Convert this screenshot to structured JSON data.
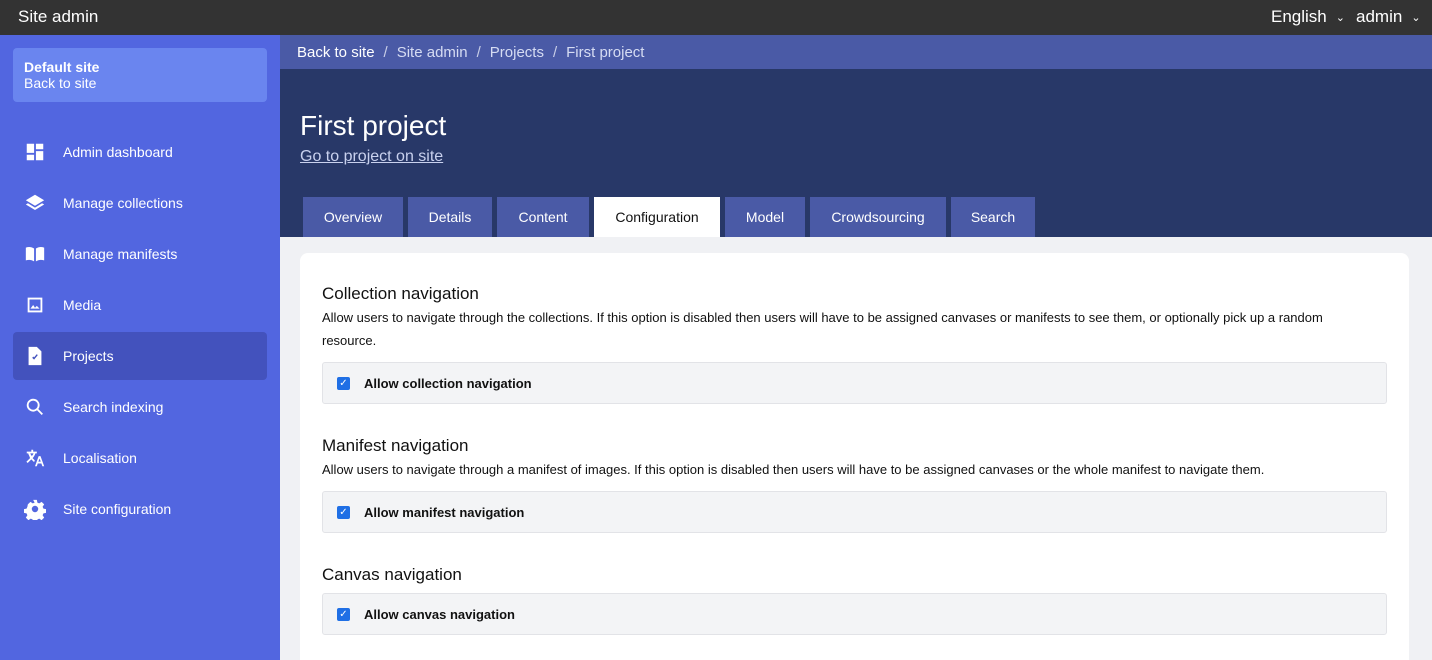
{
  "topbar": {
    "title": "Site admin",
    "language": "English",
    "user": "admin"
  },
  "sidebar": {
    "site_name": "Default site",
    "site_link": "Back to site",
    "items": [
      {
        "label": "Admin dashboard",
        "icon": "dashboard-icon"
      },
      {
        "label": "Manage collections",
        "icon": "layers-icon"
      },
      {
        "label": "Manage manifests",
        "icon": "book-icon"
      },
      {
        "label": "Media",
        "icon": "image-icon"
      },
      {
        "label": "Projects",
        "icon": "task-icon",
        "active": true
      },
      {
        "label": "Search indexing",
        "icon": "search-icon"
      },
      {
        "label": "Localisation",
        "icon": "translate-icon"
      },
      {
        "label": "Site configuration",
        "icon": "gear-icon"
      }
    ]
  },
  "breadcrumb": [
    "Back to site",
    "Site admin",
    "Projects",
    "First project"
  ],
  "header": {
    "title": "First project",
    "link": "Go to project on site"
  },
  "tabs": [
    "Overview",
    "Details",
    "Content",
    "Configuration",
    "Model",
    "Crowdsourcing",
    "Search"
  ],
  "active_tab": "Configuration",
  "sections": [
    {
      "title": "Collection navigation",
      "description": "Allow users to navigate through the collections. If this option is disabled then users will have to be assigned canvases or manifests to see them, or optionally pick up a random resource.",
      "checkbox_label": "Allow collection navigation",
      "checked": true
    },
    {
      "title": "Manifest navigation",
      "description": "Allow users to navigate through a manifest of images. If this option is disabled then users will have to be assigned canvases or the whole manifest to navigate them.",
      "checkbox_label": "Allow manifest navigation",
      "checked": true
    },
    {
      "title": "Canvas navigation",
      "description": "",
      "checkbox_label": "Allow canvas navigation",
      "checked": true
    }
  ],
  "colors": {
    "topbar": "#333333",
    "sidebar": "#5266e0",
    "sidebar_active": "#4352bd",
    "header": "#283868",
    "tab": "#4a5aa6",
    "checkbox": "#1f6fe5"
  }
}
